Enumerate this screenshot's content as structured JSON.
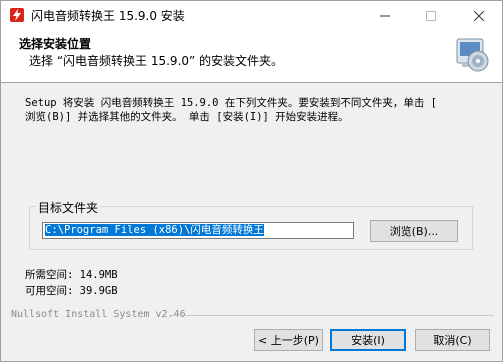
{
  "window": {
    "title": "闪电音频转换王 15.9.0 安装"
  },
  "header": {
    "title": "选择安装位置",
    "subtitle": "选择 “闪电音频转换王 15.9.0” 的安装文件夹。"
  },
  "description": {
    "line1": "Setup 将安装 闪电音频转换王 15.9.0 在下列文件夹。要安装到不同文件夹，单击 [",
    "line2": "浏览(B)] 并选择其他的文件夹。 单击 [安装(I)] 开始安装进程。"
  },
  "destination": {
    "group_label": "目标文件夹",
    "path": "C:\\Program Files (x86)\\闪电音频转换王",
    "browse_label": "浏览(B)..."
  },
  "space": {
    "required": "所需空间: 14.9MB",
    "available": "可用空间: 39.9GB"
  },
  "branding": "Nullsoft Install System v2.46",
  "buttons": {
    "back": "< 上一步(P)",
    "install": "安装(I)",
    "cancel": "取消(C)"
  },
  "colors": {
    "selection": "#0078d7",
    "accent_red": "#d9261c"
  },
  "icons": {
    "app": "lightning-app-icon",
    "header": "installer-cd-icon",
    "minimize": "minimize-icon",
    "maximize": "maximize-icon",
    "close": "close-icon"
  }
}
